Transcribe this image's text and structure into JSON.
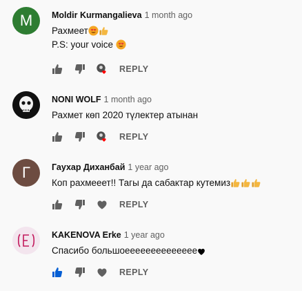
{
  "comments": [
    {
      "author": "Moldir Kurmangalieva",
      "time": "1 month ago",
      "avatar_letter": "M",
      "avatar_color": "#2e7d32",
      "lines": [
        "Рахмеет",
        "P.S: your voice"
      ],
      "reply_label": "REPLY",
      "liked": false,
      "hearted_by_creator": true
    },
    {
      "author": "NONI WOLF",
      "time": "1 month ago",
      "avatar_letter": "",
      "avatar_color": "#111111",
      "lines": [
        "Рахмет көп 2020 түлектер атынан"
      ],
      "reply_label": "REPLY",
      "liked": false,
      "hearted_by_creator": true
    },
    {
      "author": "Гаухар Диханбай",
      "time": "1 year ago",
      "avatar_letter": "Г",
      "avatar_color": "#6d4c41",
      "lines": [
        "Коп рахмееет!! Тагы да сабактар кутемиз"
      ],
      "reply_label": "REPLY",
      "liked": false,
      "hearted_by_creator": false
    },
    {
      "author": "KAKENOVA Erke",
      "time": "1 year ago",
      "avatar_letter": "E",
      "avatar_color": "#f3e5ee",
      "lines": [
        "Спасибо большоееееееееееееее"
      ],
      "reply_label": "REPLY",
      "liked": true,
      "hearted_by_creator": false
    }
  ],
  "icons": {
    "like": "thumbs-up-icon",
    "dislike": "thumbs-down-icon",
    "heart": "heart-icon",
    "creator_heart": "creator-heart-icon"
  },
  "colors": {
    "icon": "#606060",
    "liked": "#065fd4",
    "heart": "#ff0000"
  }
}
